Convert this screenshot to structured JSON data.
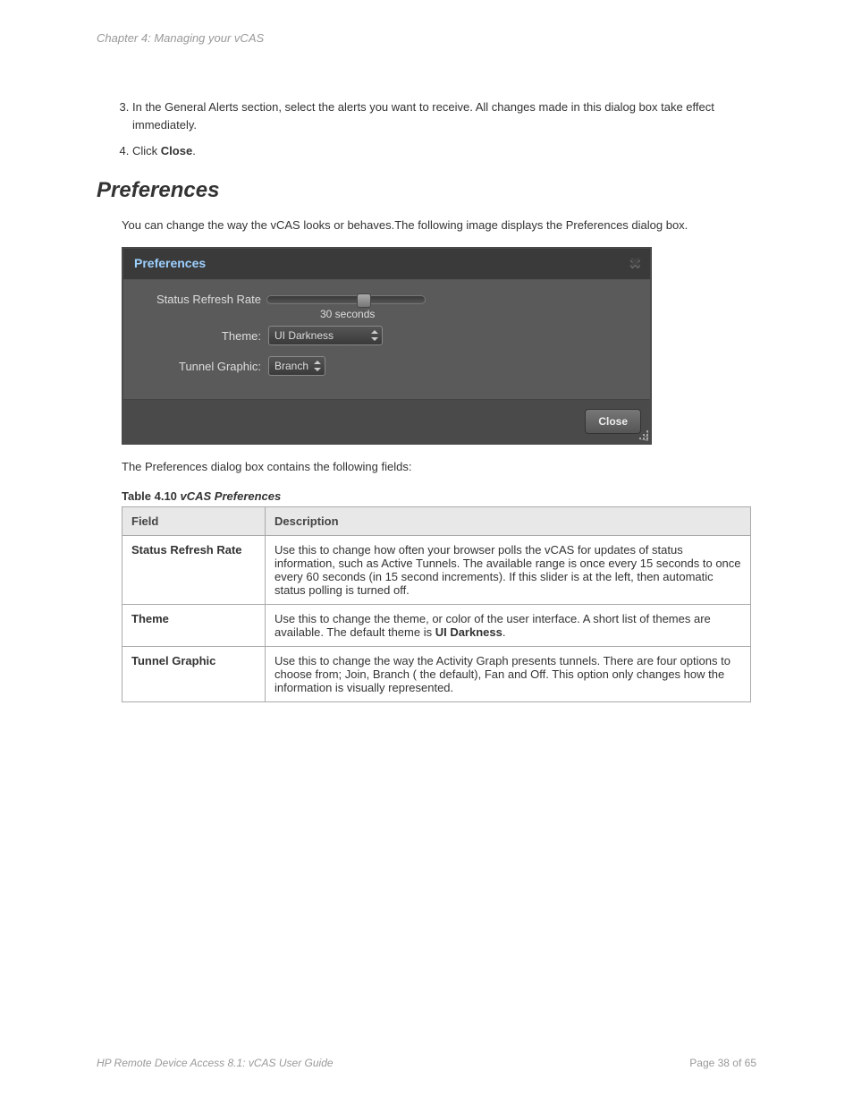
{
  "chapter_header": "Chapter 4: Managing your vCAS",
  "list": {
    "item3": "In the General Alerts section, select the alerts you want to receive. All changes made in this dialog box take effect immediately.",
    "item4_prefix": "Click ",
    "item4_bold": "Close",
    "item4_suffix": "."
  },
  "section_title": "Preferences",
  "intro_para": "You can change the way the vCAS looks or behaves.The following image displays the Preferences dialog box.",
  "dialog": {
    "title": "Preferences",
    "close_x": "✖",
    "fields": {
      "status_refresh": {
        "label": "Status Refresh Rate",
        "value": "30 seconds"
      },
      "theme": {
        "label": "Theme:",
        "value": "UI Darkness"
      },
      "tunnel_graphic": {
        "label": "Tunnel Graphic:",
        "value": "Branch"
      }
    },
    "close_btn": "Close"
  },
  "after_dialog": "The Preferences dialog box contains the following fields:",
  "table_caption": {
    "prefix": "Table 4.10 ",
    "title": "vCAS Preferences"
  },
  "table": {
    "headers": {
      "field": "Field",
      "desc": "Description"
    },
    "rows": [
      {
        "field": "Status Refresh Rate",
        "desc": "Use this to change how often your browser polls the vCAS for updates of status information, such as Active Tunnels. The available range is once every 15 seconds to once every 60 seconds (in 15 second increments). If this slider is at the left, then automatic status polling is turned off."
      },
      {
        "field": "Theme",
        "desc_pre": "Use this to change the theme, or color of the user interface. A short list of themes are available. The default theme is ",
        "desc_bold": "UI Darkness",
        "desc_post": "."
      },
      {
        "field": "Tunnel Graphic",
        "desc": "Use this to change the way the Activity Graph presents tunnels. There are four options to choose from; Join, Branch ( the default), Fan and Off. This option only changes how the information is visually represented."
      }
    ]
  },
  "footer": {
    "doc": "HP Remote Device Access 8.1: vCAS User Guide",
    "page": "Page 38 of 65"
  }
}
